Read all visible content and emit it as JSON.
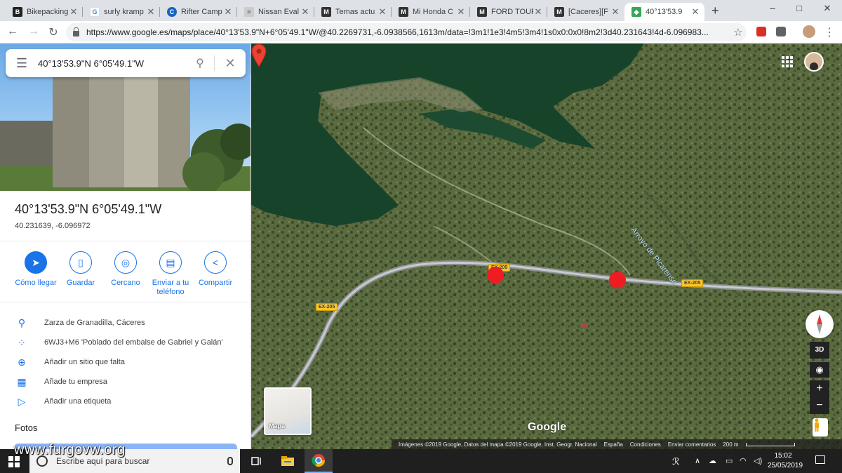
{
  "tabs": [
    {
      "title": "Bikepacking",
      "icon": "bikepacking-favicon",
      "color": "#222222"
    },
    {
      "title": "surly kramp",
      "icon": "google-favicon",
      "color": "#4285f4"
    },
    {
      "title": "Rifter Camp",
      "icon": "rifter-favicon",
      "color": "#1565c0"
    },
    {
      "title": "Nissan Eval",
      "icon": "nissan-favicon",
      "color": "#888888"
    },
    {
      "title": "Temas actu",
      "icon": "forum-favicon",
      "color": "#333333"
    },
    {
      "title": "Mi Honda C",
      "icon": "forum-favicon",
      "color": "#333333"
    },
    {
      "title": "FORD TOUR",
      "icon": "forum-favicon",
      "color": "#333333"
    },
    {
      "title": "[Caceres][F",
      "icon": "forum-favicon",
      "color": "#333333"
    },
    {
      "title": "40°13'53.9",
      "icon": "google-maps-favicon",
      "color": "#34a853"
    }
  ],
  "window": {
    "minimize": "–",
    "maximize": "□",
    "close": "✕",
    "new_tab": "+"
  },
  "toolbar": {
    "url": "https://www.google.es/maps/place/40°13'53.9\"N+6°05'49.1\"W/@40.2269731,-6.0938566,1613m/data=!3m1!1e3!4m5!3m4!1s0x0:0x0!8m2!3d40.231643!4d-6.096983...",
    "star": "☆"
  },
  "search": {
    "query": "40°13'53.9\"N 6°05'49.1\"W"
  },
  "place": {
    "title": "40°13'53.9\"N 6°05'49.1\"W",
    "decimal": "40.231639, -6.096972"
  },
  "actions": [
    {
      "label": "Cómo llegar",
      "icon": "directions-icon"
    },
    {
      "label": "Guardar",
      "icon": "bookmark-icon"
    },
    {
      "label": "Cercano",
      "icon": "nearby-icon"
    },
    {
      "label": "Enviar a tu teléfono",
      "icon": "send-to-phone-icon"
    },
    {
      "label": "Compartir",
      "icon": "share-icon"
    }
  ],
  "info": [
    {
      "text": "Zarza de Granadilla, Cáceres",
      "icon": "location-pin-icon"
    },
    {
      "text": "6WJ3+M6 'Poblado del embalse de Gabriel y Galán'",
      "icon": "plus-code-icon"
    },
    {
      "text": "Añadir un sitio que falta",
      "icon": "add-place-icon"
    },
    {
      "text": "Añade tu empresa",
      "icon": "add-business-icon"
    },
    {
      "text": "Añadir una etiqueta",
      "icon": "label-icon"
    }
  ],
  "fotos_heading": "Fotos",
  "map": {
    "stream_label": "Arroyo de Picarense",
    "road_shields": [
      "EX-205",
      "EX-205",
      "EX-205"
    ],
    "thumb_label": "Mapa",
    "google_logo": "Google",
    "compass_3d": "3D",
    "zoom_in": "+",
    "zoom_out": "−",
    "attribution": "Imágenes ©2019 Google, Datos del mapa ©2019 Google, Inst. Geogr. Nacional",
    "country": "España",
    "terms": "Condiciones",
    "feedback": "Enviar comentarios",
    "scale": "200 m",
    "marker_color": "#ea4335",
    "dot_color": "#ee1d23"
  },
  "taskbar": {
    "search_placeholder": "Escribe aquí para buscar",
    "watermark": "www.furgovw.org",
    "time": "15:02",
    "date": "25/05/2019"
  }
}
